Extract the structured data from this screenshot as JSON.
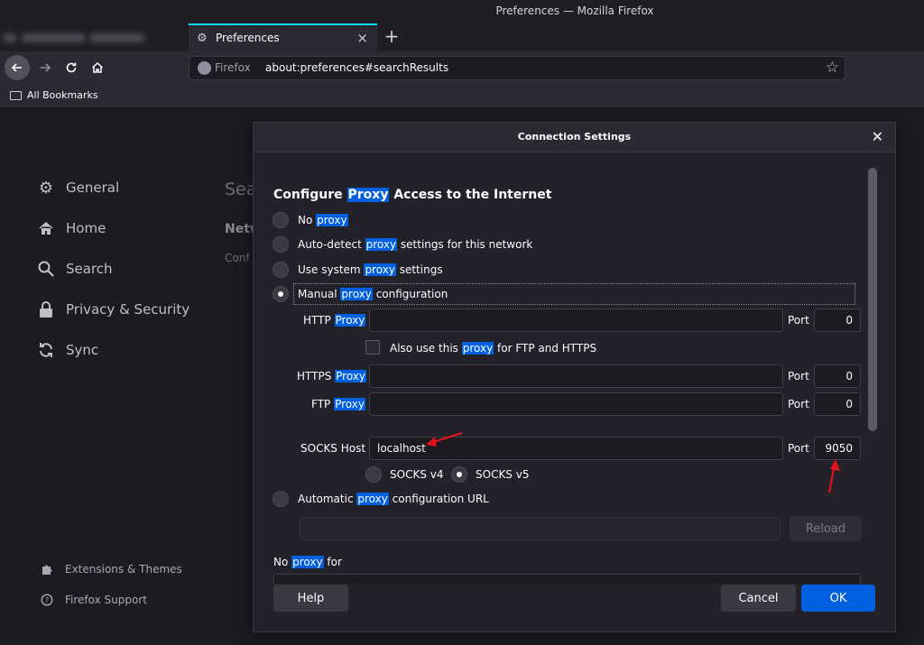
{
  "window": {
    "title": "Preferences — Mozilla Firefox"
  },
  "tab": {
    "label": "Preferences",
    "close": "×",
    "new_tab": "+"
  },
  "nav": {
    "identity": "Firefox",
    "url": "about:preferences#searchResults"
  },
  "bookmarks": {
    "label": "All Bookmarks"
  },
  "sidebar": {
    "items": [
      {
        "label": "General",
        "icon": "gear-icon"
      },
      {
        "label": "Home",
        "icon": "home-icon"
      },
      {
        "label": "Search",
        "icon": "search-icon"
      },
      {
        "label": "Privacy & Security",
        "icon": "lock-icon"
      },
      {
        "label": "Sync",
        "icon": "sync-icon"
      }
    ],
    "footer": [
      {
        "label": "Extensions & Themes",
        "icon": "puzzle-icon"
      },
      {
        "label": "Firefox Support",
        "icon": "help-icon"
      }
    ]
  },
  "background_page": {
    "heading_partial": "Sea",
    "section_partial": "Netw",
    "text_partial": "Conf"
  },
  "dialog": {
    "title": "Connection Settings",
    "heading_pre": "Configure ",
    "heading_hl": "Proxy",
    "heading_post": " Access to the Internet",
    "options": {
      "no_proxy": {
        "pre": "No ",
        "hl": "proxy",
        "post": ""
      },
      "auto_detect": {
        "pre": "Auto-detect ",
        "hl": "proxy",
        "post": " settings for this network"
      },
      "system": {
        "pre": "Use system ",
        "hl": "proxy",
        "post": " settings"
      },
      "manual": {
        "pre": "Manual ",
        "hl": "proxy",
        "post": " configuration"
      },
      "auto_url": {
        "pre": "Automatic ",
        "hl": "proxy",
        "post": " configuration URL"
      }
    },
    "selected": "manual",
    "http": {
      "label_pre": "HTTP ",
      "label_hl": "Proxy",
      "value": "",
      "port_label": "Port",
      "port": "0"
    },
    "also_use": {
      "pre": "Also use this ",
      "hl": "proxy",
      "post": " for FTP and HTTPS",
      "checked": false
    },
    "https": {
      "label_pre": "HTTPS ",
      "label_hl": "Proxy",
      "value": "",
      "port_label": "Port",
      "port": "0"
    },
    "ftp": {
      "label_pre": "FTP ",
      "label_hl": "Proxy",
      "value": "",
      "port_label": "Port",
      "port": "0"
    },
    "socks": {
      "label": "SOCKS Host",
      "value": "localhost",
      "port_label": "Port",
      "port": "9050",
      "v4": "SOCKS v4",
      "v5": "SOCKS v5",
      "selected_version": "v5"
    },
    "auto_url_value": "",
    "reload_label": "Reload",
    "no_proxy_for": {
      "pre": "No ",
      "hl": "proxy",
      "post": " for"
    },
    "buttons": {
      "help": "Help",
      "cancel": "Cancel",
      "ok": "OK"
    }
  },
  "colors": {
    "accent": "#0060df",
    "annotation_arrow": "#e0121b",
    "tab_highlight": "#00ddff"
  }
}
